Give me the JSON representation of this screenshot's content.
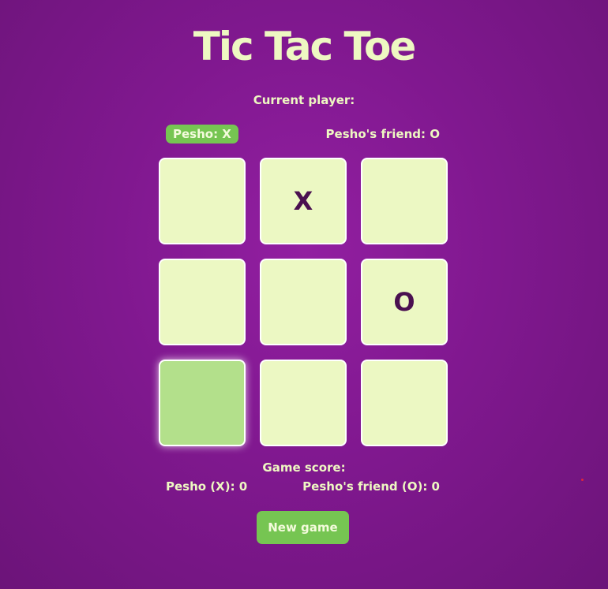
{
  "title": "Tic Tac Toe",
  "current_player_label": "Current player:",
  "players": {
    "active": "Pesho: X",
    "other": "Pesho's friend: O"
  },
  "board": {
    "cells": [
      "",
      "X",
      "",
      "",
      "",
      "O",
      "",
      "",
      ""
    ],
    "highlighted_cell_index": 6
  },
  "score": {
    "label": "Game score:",
    "player_x": "Pesho (X): 0",
    "player_o": "Pesho's friend (O): 0"
  },
  "new_game_label": "New game",
  "colors": {
    "background": "#84199a",
    "accent_green": "#76c552",
    "cell": "#ecf8c3",
    "cell_highlight": "#b3e08b",
    "text": "#eef8c2",
    "mark": "#4a1050"
  }
}
